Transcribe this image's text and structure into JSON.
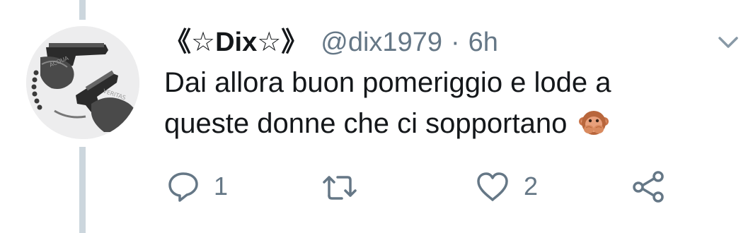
{
  "tweet": {
    "display_name": "《☆Dix☆》",
    "handle": "@dix1979",
    "separator": "·",
    "time": "6h",
    "text_line1": "Dai allora buon pomeriggio e lode a",
    "text_line2": "queste donne che ci sopportano",
    "emoji_name": "speak-no-evil-monkey-emoji",
    "avatar_text_left": "ACQUA",
    "avatar_text_right": "VERITAS"
  },
  "actions": {
    "reply_count": "1",
    "retweet_count": "",
    "like_count": "2"
  },
  "colors": {
    "text_primary": "#14171a",
    "text_secondary": "#657786",
    "thread_line": "#ccd6dd",
    "icon_gray": "#657786"
  },
  "icons": {
    "more": "chevron-down-icon",
    "reply": "reply-icon",
    "retweet": "retweet-icon",
    "like": "heart-icon",
    "share": "share-icon"
  }
}
